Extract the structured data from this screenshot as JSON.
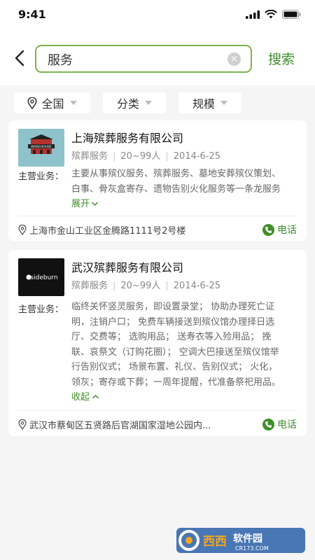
{
  "status": {
    "time": "9:41"
  },
  "search": {
    "value": "服务",
    "button": "搜索"
  },
  "filters": [
    {
      "label": "全国",
      "icon": "location-pin-icon"
    },
    {
      "label": "分类"
    },
    {
      "label": "规模"
    }
  ],
  "results": [
    {
      "name": "上海殡葬服务有限公司",
      "category": "殡葬服务",
      "size": "20~99人",
      "date": "2014-6-25",
      "business_label": "主营业务：",
      "business": "主要从事殡仪服务、殡葬服务、墓地安葬殡仪策划、白事、骨灰盒寄存、遗物告别火化服务等一条龙服务",
      "toggle": "展开",
      "address": "上海市金山工业区金腾路1111号2号楼",
      "call": "电话",
      "logo_text": "WAREHOUSE"
    },
    {
      "name": "武汉殡葬服务有限公司",
      "category": "殡葬服务",
      "size": "20~99人",
      "date": "2014-6-25",
      "business_label": "主营业务：",
      "business": "临终关怀竖灵服务，即设置录堂； 协助办理死亡证明，注销户口； 免费车辆接送到殡仪馆办理择日选厅、交费等； 选购用品； 送寿衣等入殓用品； 挽联、哀祭文（订购花圈）； 空调大巴接送至殡仪馆举行告别仪式； 场景布置、礼仪、告别仪式； 火化，领灰；寄存或下葬；一周年提醒，代准备祭祀用品。",
      "toggle": "收起",
      "address": "武汉市蔡甸区五贤路后官湖国家湿地公园内...",
      "call": "电话",
      "logo_text": "sideburn"
    }
  ],
  "watermark": {
    "brand": "西西",
    "text": "软件园",
    "url": "CR173.COM"
  },
  "colors": {
    "accent": "#3f8e2a",
    "search_border": "#7bb24f"
  }
}
